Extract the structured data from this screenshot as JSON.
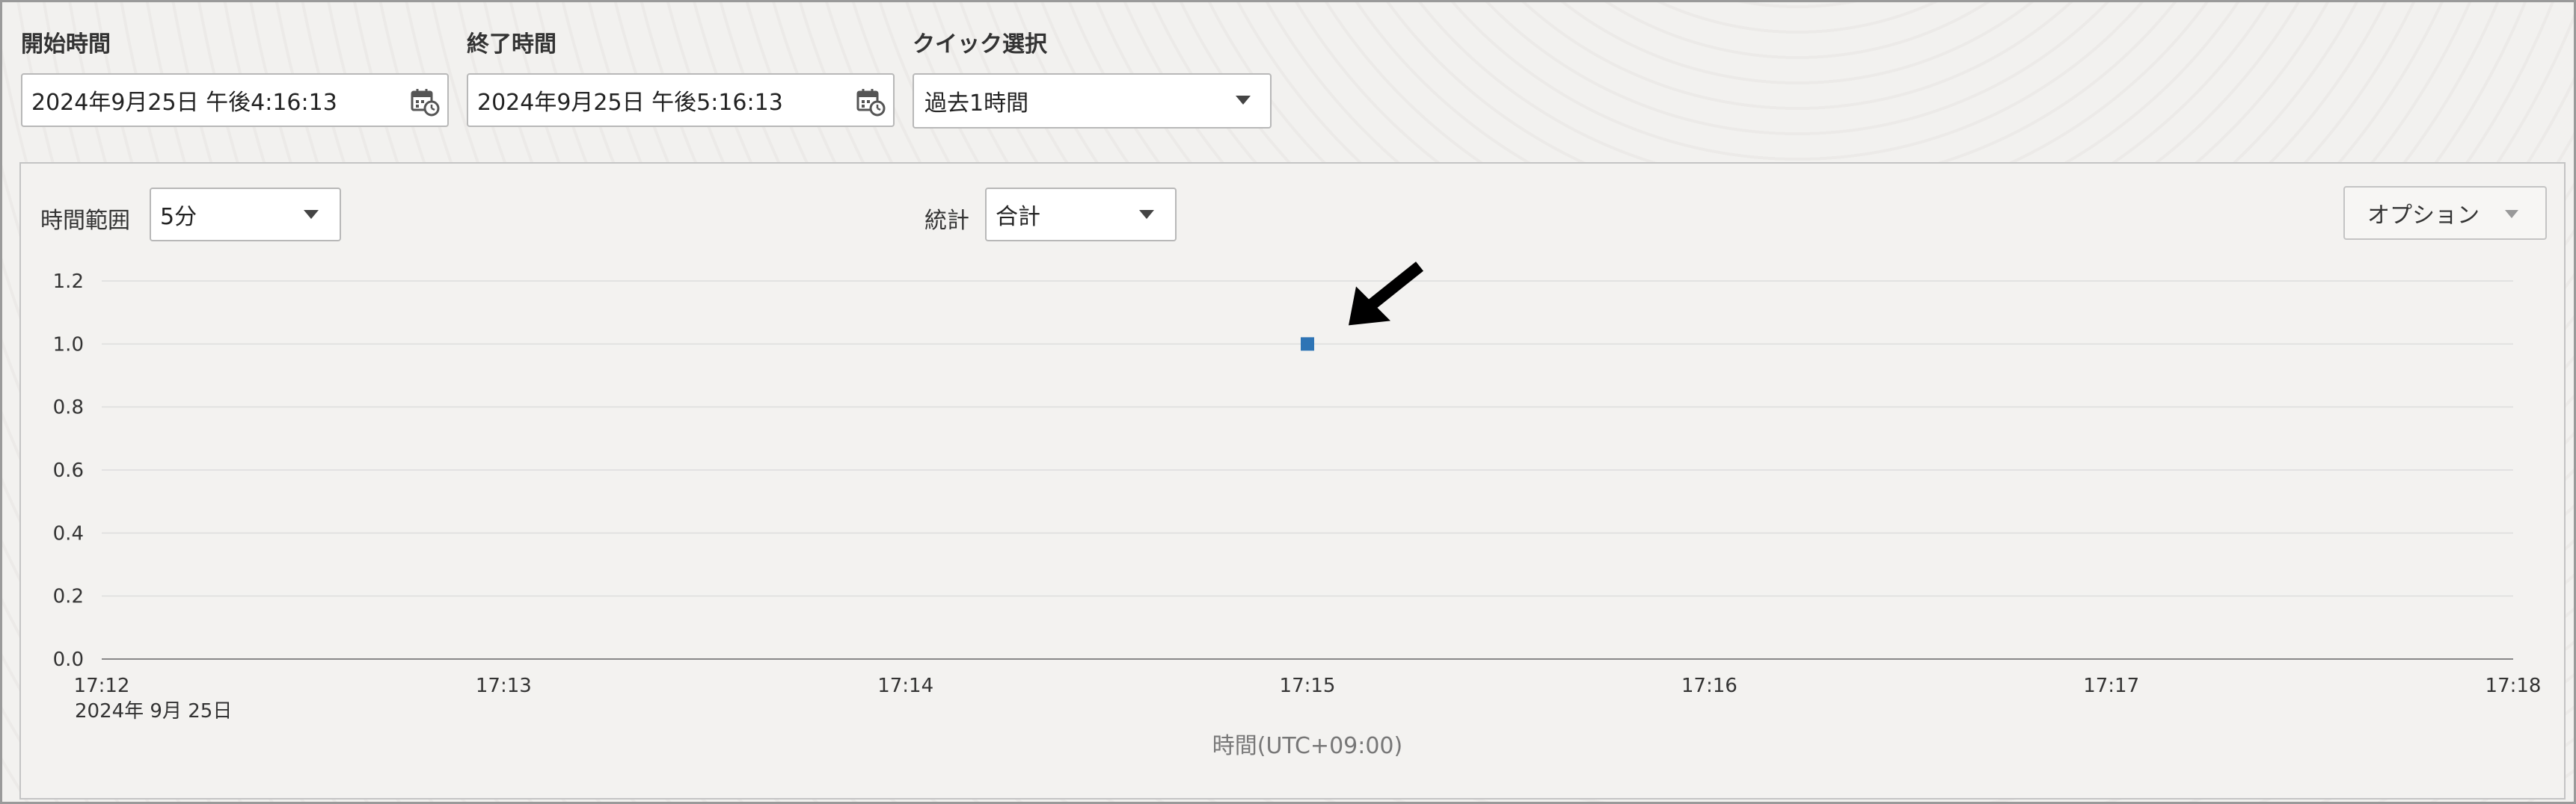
{
  "filters": {
    "start_label": "開始時間",
    "start_value": "2024年9月25日 午後4:16:13",
    "end_label": "終了時間",
    "end_value": "2024年9月25日 午後5:16:13",
    "quick_label": "クイック選択",
    "quick_value": "過去1時間"
  },
  "chart_controls": {
    "range_label": "時間範囲",
    "range_value": "5分",
    "stat_label": "統計",
    "stat_value": "合計",
    "options_label": "オプション"
  },
  "colors": {
    "point": "#2e74b5",
    "grid": "#dddddd",
    "axis": "#888888",
    "arrow": "#000000"
  },
  "chart_data": {
    "type": "scatter",
    "x_ticks": [
      "17:12",
      "17:13",
      "17:14",
      "17:15",
      "17:16",
      "17:17",
      "17:18"
    ],
    "x_sublabel": "2024年 9月 25日",
    "y_ticks": [
      "0.0",
      "0.2",
      "0.4",
      "0.6",
      "0.8",
      "1.0",
      "1.2"
    ],
    "ylim": [
      0,
      1.2
    ],
    "xlabel": "時間(UTC+09:00)",
    "ylabel": "",
    "grid": true,
    "series": [
      {
        "points": [
          {
            "x": "17:15",
            "y": 1.0
          }
        ]
      }
    ],
    "annotation": "arrow-pointing-to-point"
  }
}
